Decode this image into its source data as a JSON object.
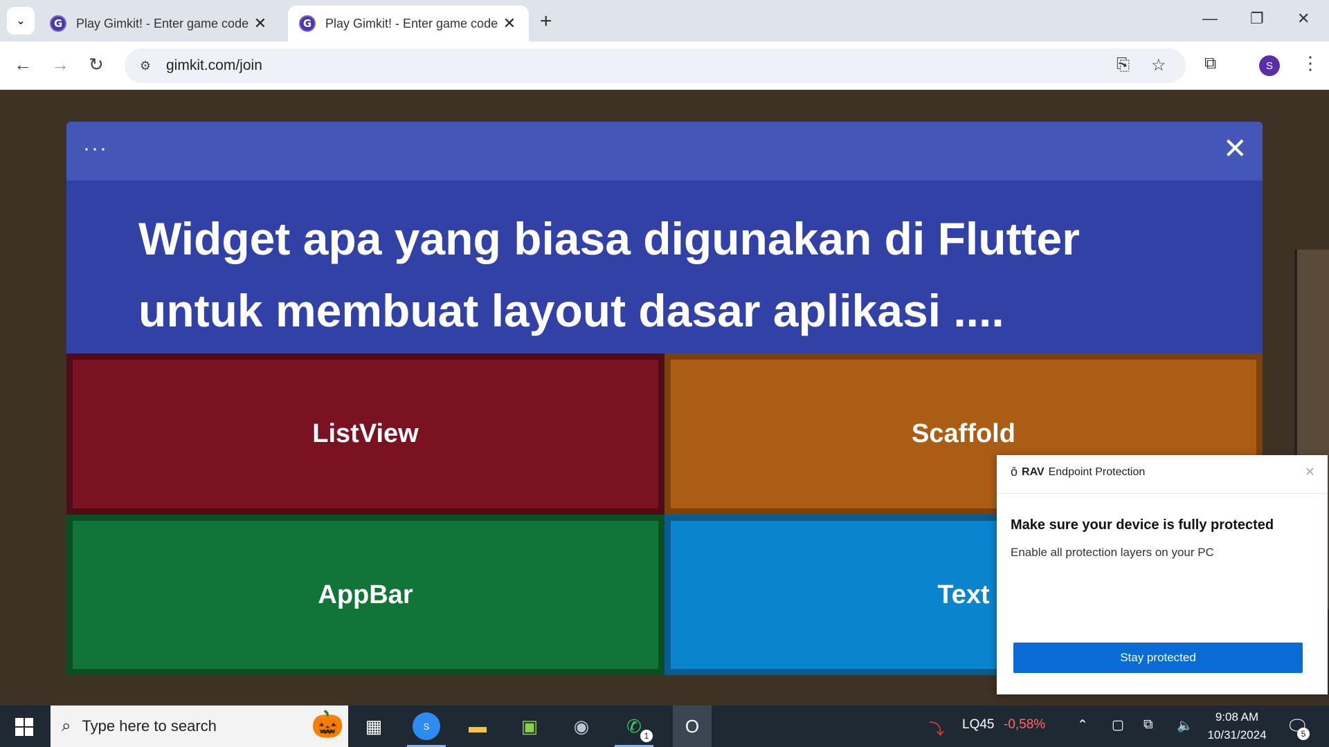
{
  "browser": {
    "tabs": [
      {
        "title": "Play Gimkit! - Enter game code",
        "favicon": "G",
        "active": false
      },
      {
        "title": "Play Gimkit! - Enter game code",
        "favicon": "G",
        "active": true
      }
    ],
    "url": "gimkit.com/join",
    "profile_initial": "S"
  },
  "quiz": {
    "question": "Widget apa yang biasa digunakan di Flutter untuk membuat layout dasar aplikasi ....",
    "answers": [
      "ListView",
      "Scaffold",
      "AppBar",
      "Text"
    ],
    "colors": {
      "a1": "#7a1222",
      "a2": "#ab5c15",
      "a3": "#127538",
      "a4": "#0a84cc",
      "header": "#3141a6"
    }
  },
  "popup": {
    "brand_bold": "RAV",
    "brand_rest": "Endpoint Protection",
    "heading": "Make sure your device is fully protected",
    "subtext": "Enable all protection layers on your PC",
    "button": "Stay protected"
  },
  "taskbar": {
    "search_placeholder": "Type here to search",
    "stock_symbol": "LQ45",
    "stock_change": "-0,58%",
    "time": "9:08 AM",
    "date": "10/31/2024",
    "whatsapp_badge": "1",
    "notification_count": "5",
    "chrome_badge": "S"
  }
}
